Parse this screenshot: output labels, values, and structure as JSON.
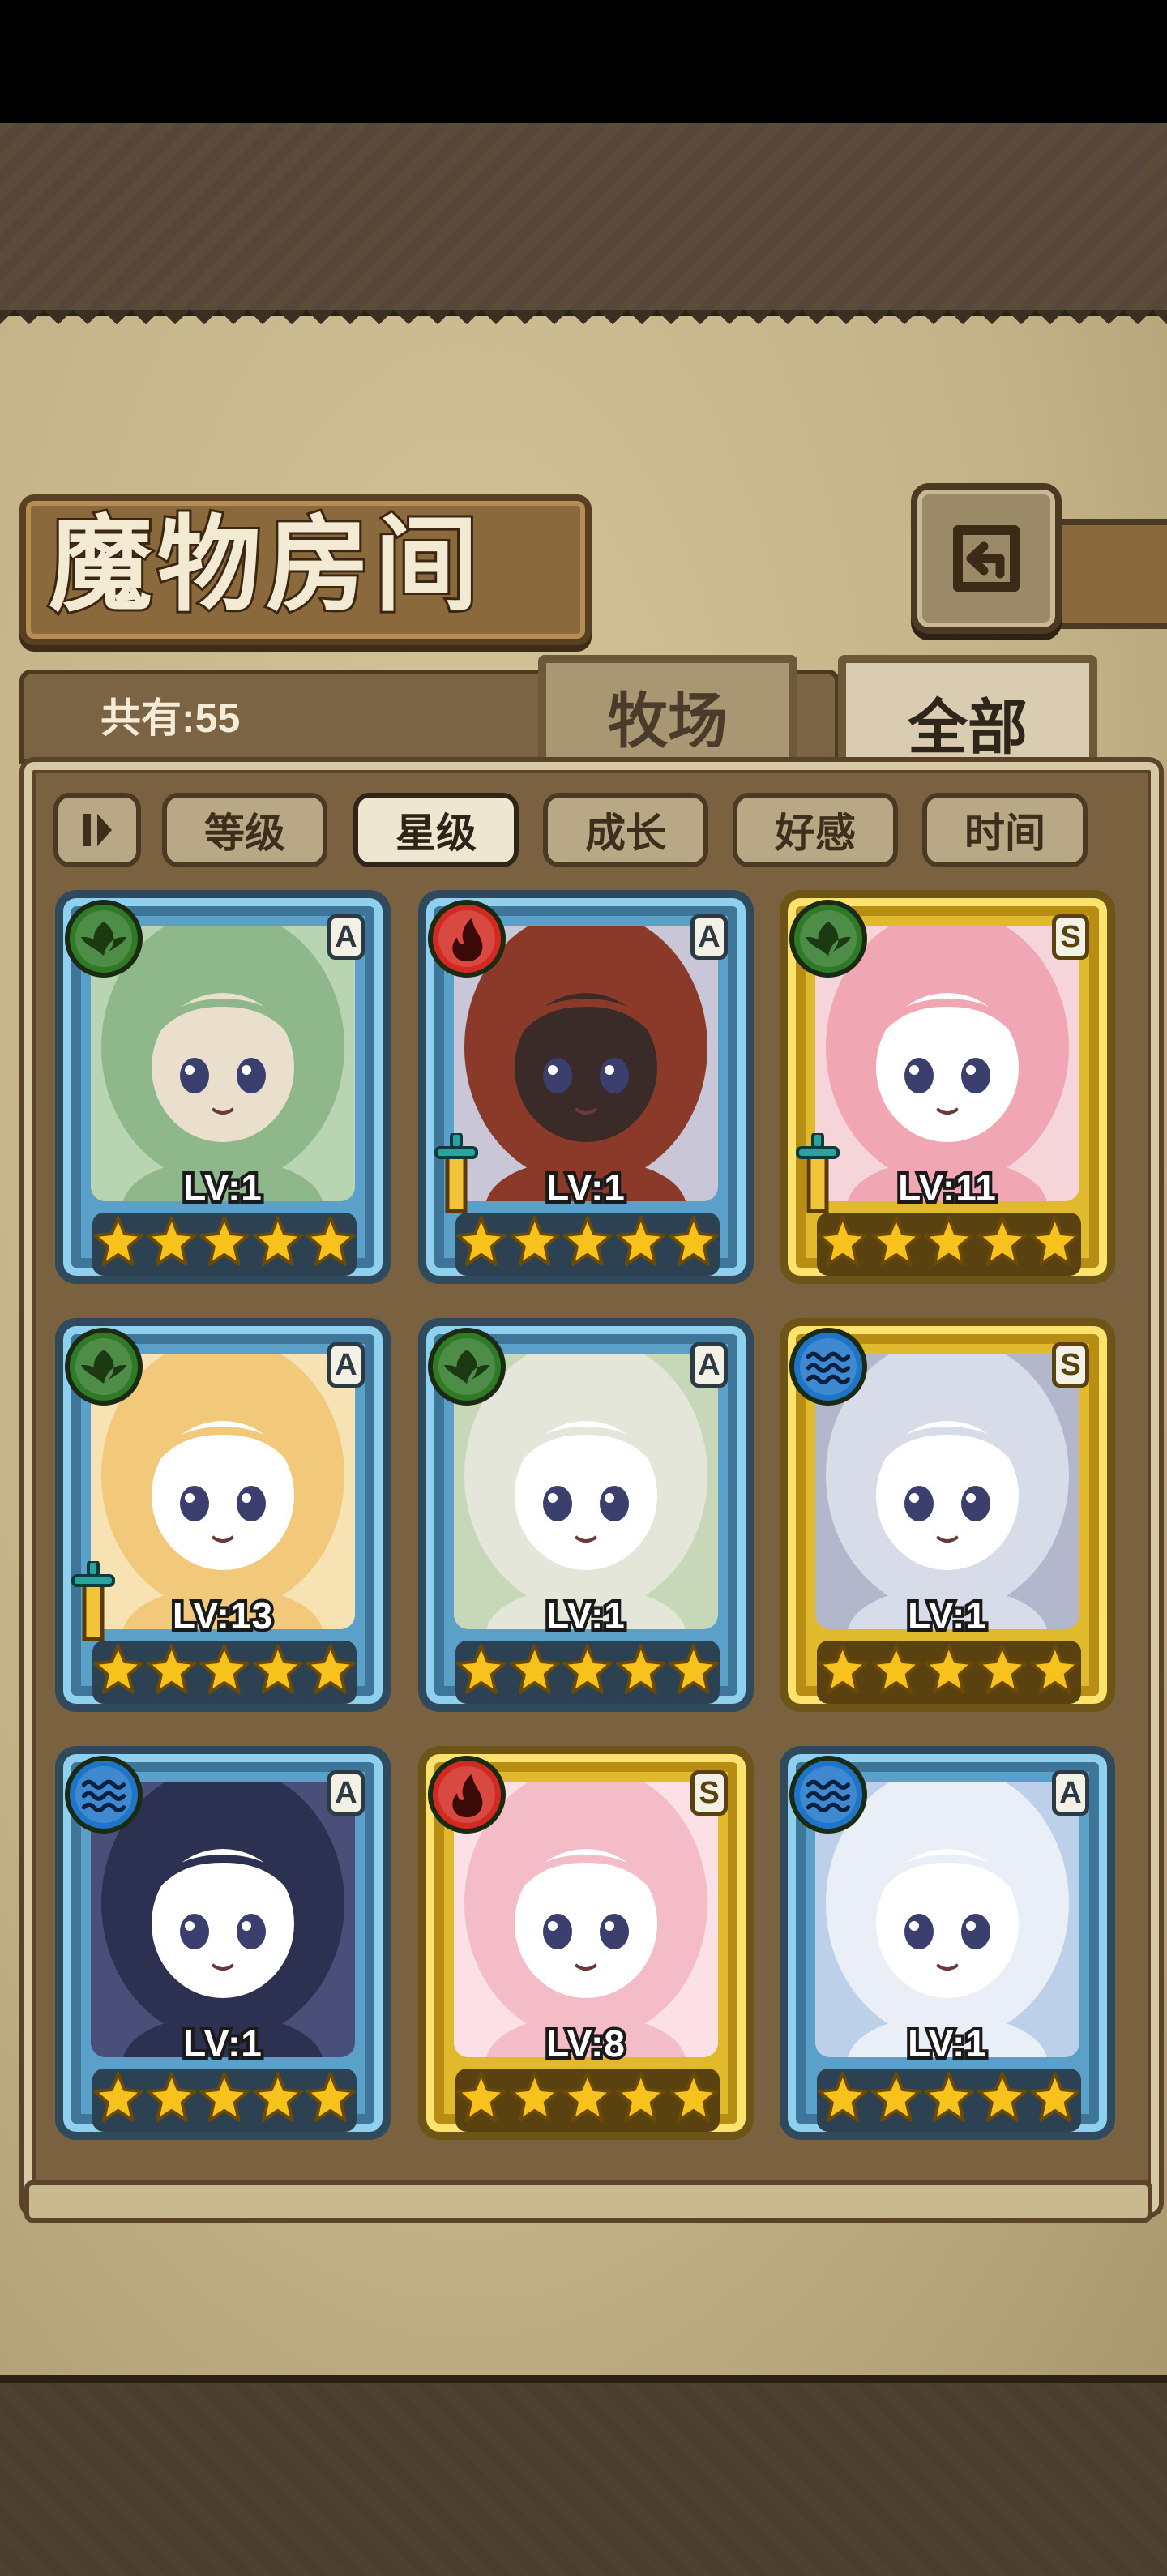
{
  "header": {
    "title": "魔物房间",
    "back_icon": "back-arrow-icon"
  },
  "summary": {
    "count_text": "共有:55"
  },
  "tabs": [
    {
      "label": "牧场",
      "selected": false
    },
    {
      "label": "全部",
      "selected": true
    }
  ],
  "sort": {
    "toggle_icon": "sort-order-icon",
    "options": [
      {
        "label": "等级",
        "active": false
      },
      {
        "label": "星级",
        "active": true
      },
      {
        "label": "成长",
        "active": false
      },
      {
        "label": "好感",
        "active": false
      },
      {
        "label": "时间",
        "active": false
      }
    ]
  },
  "monsters": [
    {
      "level": "LV:1",
      "rank": "A",
      "element": "wood",
      "frame": "blue",
      "stars": 5,
      "weapon": false,
      "palette": [
        "#8fb88a",
        "#b9d4b0",
        "#e9dfcc"
      ]
    },
    {
      "level": "LV:1",
      "rank": "A",
      "element": "fire",
      "frame": "blue",
      "stars": 5,
      "weapon": true,
      "palette": [
        "#8b3a2a",
        "#c9c6d8",
        "#3b2b28"
      ]
    },
    {
      "level": "LV:11",
      "rank": "S",
      "element": "wood",
      "frame": "gold",
      "stars": 5,
      "weapon": true,
      "palette": [
        "#f0a7b3",
        "#f6d5da",
        "#ffffff"
      ]
    },
    {
      "level": "LV:13",
      "rank": "A",
      "element": "wood",
      "frame": "blue",
      "stars": 5,
      "weapon": true,
      "palette": [
        "#f2c97b",
        "#f7e2b4",
        "#ffffff"
      ]
    },
    {
      "level": "LV:1",
      "rank": "A",
      "element": "wood",
      "frame": "blue",
      "stars": 5,
      "weapon": false,
      "palette": [
        "#e4e6da",
        "#c7d8b9",
        "#ffffff"
      ]
    },
    {
      "level": "LV:1",
      "rank": "S",
      "element": "water",
      "frame": "gold",
      "stars": 5,
      "weapon": false,
      "palette": [
        "#d8dbe8",
        "#b3b7cc",
        "#ffffff"
      ]
    },
    {
      "level": "LV:1",
      "rank": "A",
      "element": "water",
      "frame": "blue",
      "stars": 5,
      "weapon": false,
      "palette": [
        "#2c3152",
        "#4a4f7a",
        "#ffffff"
      ]
    },
    {
      "level": "LV:8",
      "rank": "S",
      "element": "fire",
      "frame": "gold",
      "stars": 5,
      "weapon": false,
      "palette": [
        "#f4bcc6",
        "#fbe0e5",
        "#ffffff"
      ]
    },
    {
      "level": "LV:1",
      "rank": "A",
      "element": "water",
      "frame": "blue",
      "stars": 5,
      "weapon": false,
      "palette": [
        "#e9eef7",
        "#bcd0ea",
        "#ffffff"
      ]
    }
  ]
}
